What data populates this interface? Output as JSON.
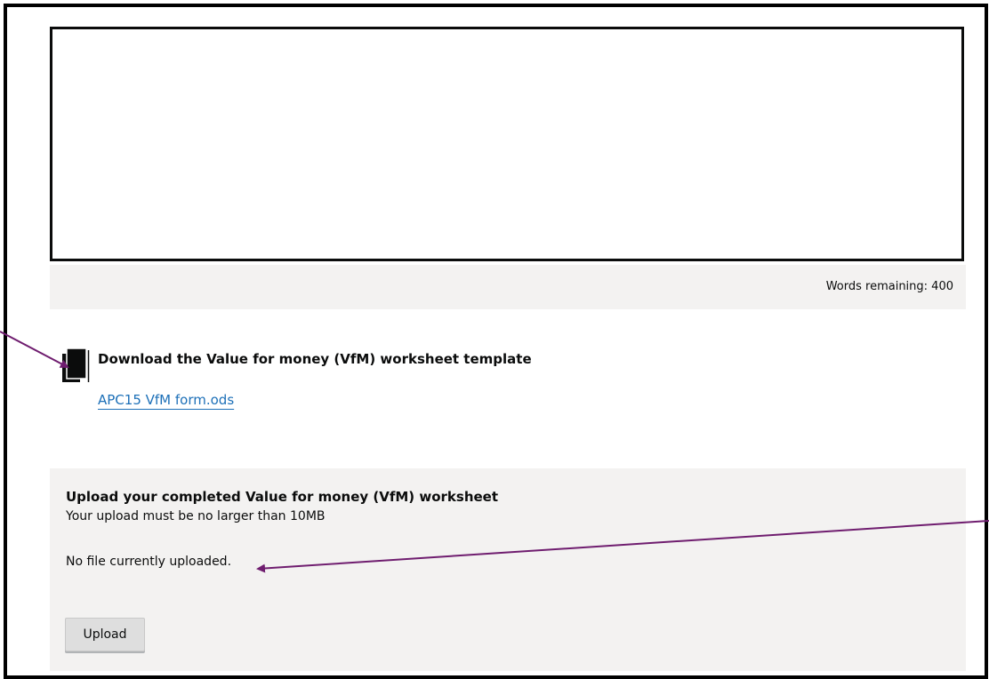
{
  "text_entry": {
    "value": "",
    "words_remaining": "Words remaining: 400"
  },
  "download": {
    "icon": "document-icon",
    "heading": "Download the Value for money (VfM) worksheet template",
    "link_text": "APC15 VfM form.ods"
  },
  "upload": {
    "title": "Upload your completed Value for money (VfM) worksheet",
    "hint": "Your upload must be no larger than 10MB",
    "status": "No file currently uploaded.",
    "button_label": "Upload"
  },
  "annotations": {
    "arrow_color": "#6f1d6f"
  },
  "colors": {
    "link": "#1d70b8",
    "panel_background": "#f3f2f1",
    "text": "#0b0c0c"
  }
}
